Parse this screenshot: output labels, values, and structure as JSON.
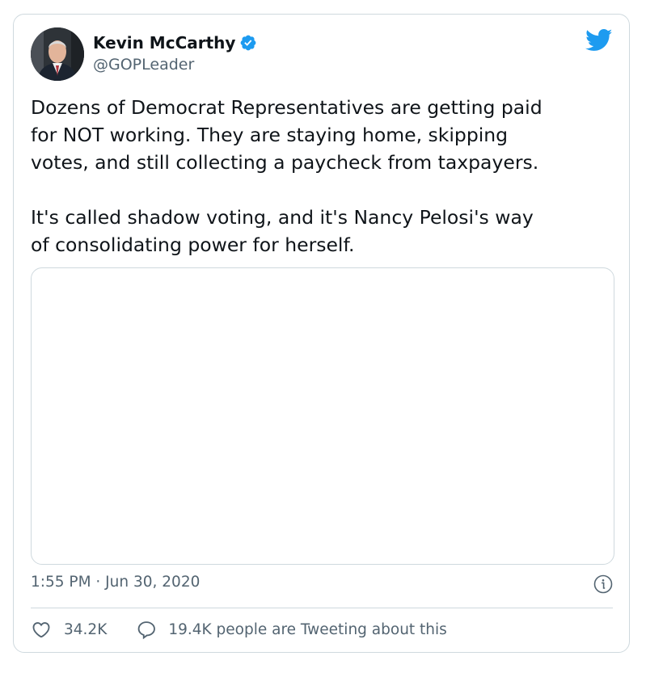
{
  "author": {
    "name": "Kevin McCarthy",
    "handle": "@GOPLeader",
    "verified": true
  },
  "tweet": {
    "text": "Dozens of Democrat Representatives are getting paid\nfor NOT working. They are staying home, skipping\nvotes, and still collecting a paycheck from taxpayers.\n\nIt's called shadow voting, and it's Nancy Pelosi's way\nof consolidating power for herself.",
    "timestamp": "1:55 PM · Jun 30, 2020"
  },
  "engagement": {
    "likes": "34.2K",
    "tweeting_text": "19.4K people are Tweeting about this"
  },
  "icons": {
    "brand": "twitter-bird-icon",
    "verified": "verified-badge-icon",
    "like": "heart-icon",
    "reply": "speech-bubble-icon",
    "info": "info-icon"
  },
  "colors": {
    "brand_blue": "#1d9bf0",
    "text_primary": "#0f1419",
    "text_secondary": "#536471",
    "border": "#cfd9de"
  }
}
